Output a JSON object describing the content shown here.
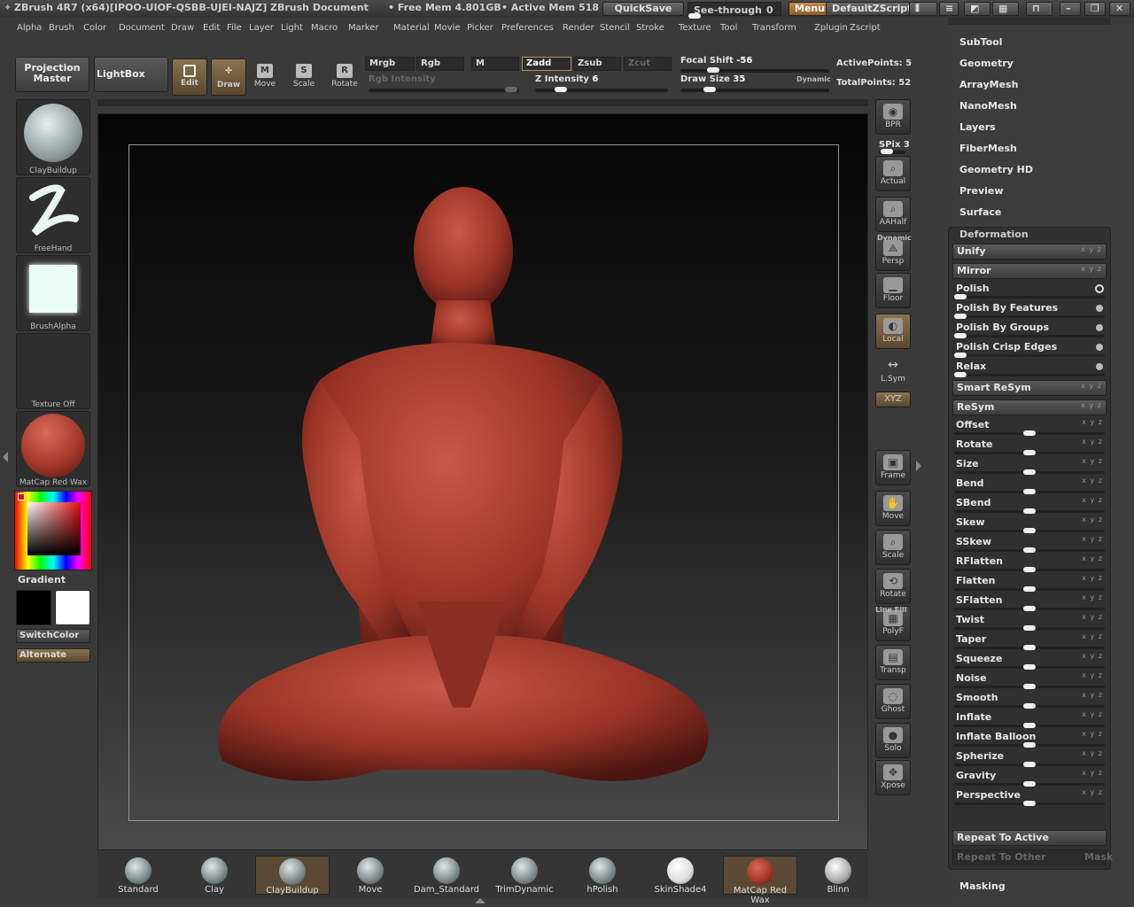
{
  "titlebar": {
    "app": "ZBrush 4R7 (x64)[IPOO-UIOF-QSBB-UJEI-NAJZ]",
    "doc": "ZBrush Document",
    "free_mem": "• Free Mem 4.801GB",
    "active_mem": "• Active Mem 518",
    "quicksave": "QuickSave",
    "see_through": "See-through",
    "see_through_val": "0",
    "menus": "Menus",
    "script": "DefaultZScript"
  },
  "menubar": [
    "Alpha",
    "Brush",
    "Color",
    "Document",
    "Draw",
    "Edit",
    "File",
    "Layer",
    "Light",
    "Macro",
    "Marker",
    "Material",
    "Movie",
    "Picker",
    "Preferences",
    "Render",
    "Stencil",
    "Stroke",
    "Texture",
    "Tool",
    "Transform",
    "Zplugin",
    "Zscript"
  ],
  "toolbar": {
    "projection_master": "Projection Master",
    "lightbox": "LightBox",
    "edit": "Edit",
    "draw": "Draw",
    "move": "Move",
    "scale": "Scale",
    "rotate": "Rotate",
    "mrgb": "Mrgb",
    "rgb": "Rgb",
    "m": "M",
    "zadd": "Zadd",
    "zsub": "Zsub",
    "zcut": "Zcut",
    "rgb_intensity": "Rgb Intensity",
    "z_intensity_label": "Z Intensity",
    "z_intensity": "6",
    "focal_shift_label": "Focal Shift",
    "focal_shift": "-56",
    "draw_size_label": "Draw Size",
    "draw_size": "35",
    "dynamic": "Dynamic",
    "active_points": "ActivePoints: 5",
    "total_points": "TotalPoints: 52"
  },
  "leftshelf": {
    "brush": "ClayBuildup",
    "stroke": "FreeHand",
    "alpha": "BrushAlpha",
    "texture": "Texture Off",
    "material": "MatCap Red Wax",
    "gradient": "Gradient",
    "switchcolor": "SwitchColor",
    "alternate": "Alternate"
  },
  "rightshelf": [
    "BPR",
    "SPix 3",
    "Actual",
    "AAHalf",
    "Persp",
    "Floor",
    "Local",
    "L.Sym",
    "XYZ",
    "Frame",
    "Move",
    "Scale",
    "Rotate",
    "PolyF",
    "Transp",
    "Ghost",
    "Solo",
    "Xpose"
  ],
  "rightshelf_extra": {
    "dynamic": "Dynamic",
    "line_fill": "Line Fill"
  },
  "brushes": [
    "Standard",
    "Clay",
    "ClayBuildup",
    "Move",
    "Dam_Standard",
    "TrimDynamic",
    "hPolish",
    "SkinShade4",
    "MatCap Red Wax",
    "Blinn"
  ],
  "panel": {
    "top_items": [
      "SubTool",
      "Geometry",
      "ArrayMesh",
      "NanoMesh",
      "Layers",
      "FiberMesh",
      "Geometry HD",
      "Preview",
      "Surface"
    ],
    "deformation_title": "Deformation",
    "rows": [
      "Unify",
      "Mirror",
      "Polish",
      "Polish By Features",
      "Polish By Groups",
      "Polish Crisp Edges",
      "Relax",
      "Smart ReSym",
      "ReSym",
      "Offset",
      "Rotate",
      "Size",
      "Bend",
      "SBend",
      "Skew",
      "SSkew",
      "RFlatten",
      "Flatten",
      "SFlatten",
      "Twist",
      "Taper",
      "Squeeze",
      "Noise",
      "Smooth",
      "Inflate",
      "Inflate Balloon",
      "Spherize",
      "Gravity",
      "Perspective"
    ],
    "repeat_active": "Repeat To Active",
    "repeat_other": "Repeat To Other",
    "mask": "Mask",
    "masking": "Masking"
  },
  "colors": {
    "accent": "#b88d50",
    "wax": "#a5392a",
    "panel": "#3c3c3c"
  }
}
